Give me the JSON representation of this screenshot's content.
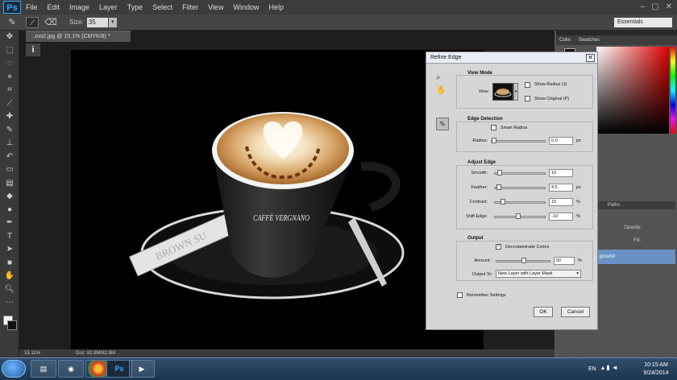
{
  "app": {
    "logo": "Ps"
  },
  "menubar": [
    "File",
    "Edit",
    "Image",
    "Layer",
    "Type",
    "Select",
    "Filter",
    "View",
    "Window",
    "Help"
  ],
  "window_controls": [
    "–",
    "▢",
    "✕"
  ],
  "options_bar": {
    "size_label": "Size:",
    "size_value": "35",
    "workspace": "Essentials"
  },
  "document": {
    "tab_title": "...ino2.jpg @ 15.1% (CMYK/8) *",
    "status_zoom": "15.11%",
    "status_doc": "Doc: 82.8M/82.8M"
  },
  "panels": {
    "tabs": [
      "Color",
      "Swatches"
    ],
    "layer_tabs": [
      "Paths"
    ],
    "opacity_label": "Opacity:",
    "fill_label": "Fill:",
    "layer_name": "ground"
  },
  "dialog": {
    "title": "Refine Edge",
    "view_mode": {
      "title": "View Mode",
      "view_label": "View:",
      "show_radius": "Show Radius (J)",
      "show_original": "Show Original (P)"
    },
    "edge_detection": {
      "title": "Edge Detection",
      "smart_radius": "Smart Radius",
      "radius_label": "Radius:",
      "radius_value": "0.0",
      "radius_unit": "px"
    },
    "adjust_edge": {
      "title": "Adjust Edge",
      "smooth_label": "Smooth:",
      "smooth_value": "10",
      "feather_label": "Feather:",
      "feather_value": "4.5",
      "feather_unit": "px",
      "contrast_label": "Contrast:",
      "contrast_value": "15",
      "contrast_unit": "%",
      "shift_label": "Shift Edge:",
      "shift_value": "-10",
      "shift_unit": "%"
    },
    "output": {
      "title": "Output",
      "decontaminate": "Decontaminate Colors",
      "amount_label": "Amount:",
      "amount_value": "50",
      "amount_unit": "%",
      "output_to_label": "Output To:",
      "output_to_value": "New Layer with Layer Mask"
    },
    "remember": "Remember Settings",
    "ok": "OK",
    "cancel": "Cancel"
  },
  "image": {
    "sugar_text": "BROWN SU",
    "brand_text": "CAFFÈ VERGNANO"
  },
  "taskbar": {
    "lang": "EN",
    "time": "10:15 AM",
    "date": "9/24/2014"
  }
}
